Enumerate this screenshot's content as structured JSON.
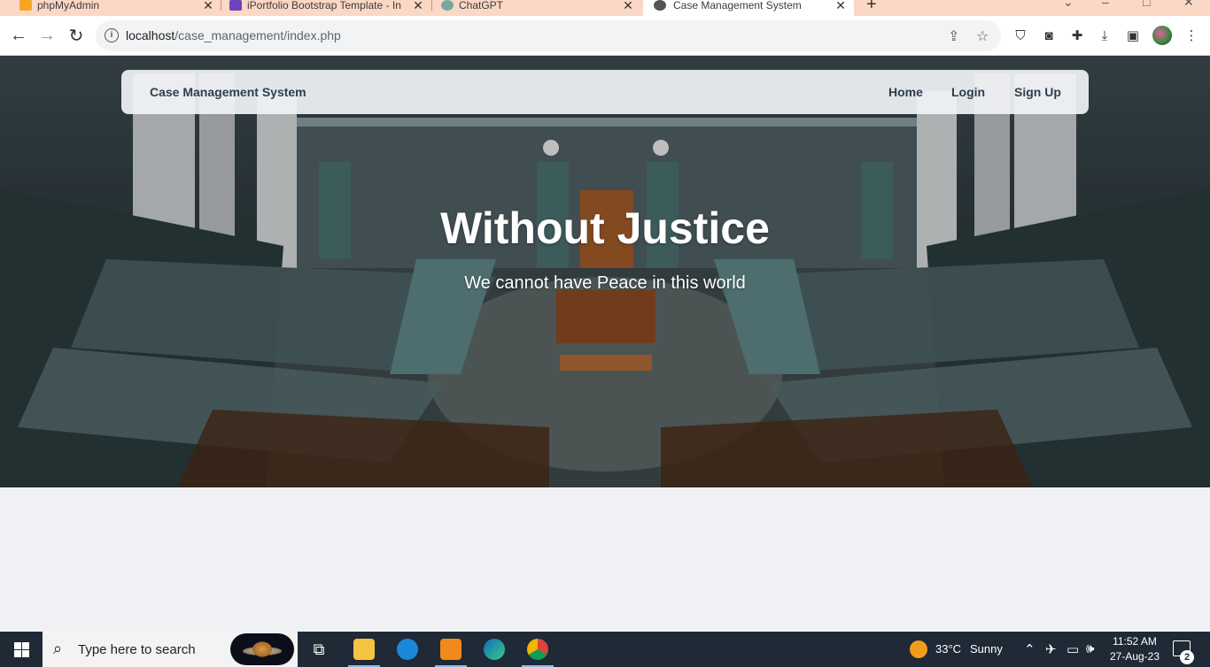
{
  "browser": {
    "tabs": [
      {
        "title": "phpMyAdmin",
        "favicon": "phpmyadmin-icon",
        "active": false
      },
      {
        "title": "iPortfolio Bootstrap Template - In",
        "favicon": "bootstrap-icon",
        "active": false
      },
      {
        "title": "ChatGPT",
        "favicon": "chatgpt-icon",
        "active": false
      },
      {
        "title": "Case Management System",
        "favicon": "globe-icon",
        "active": true
      }
    ],
    "close_glyph": "✕",
    "new_tab_glyph": "+",
    "address": {
      "host": "localhost",
      "path": "/case_management/index.php"
    }
  },
  "site": {
    "brand": "Case Management System",
    "nav": {
      "home": "Home",
      "login": "Login",
      "signup": "Sign Up"
    },
    "hero": {
      "title": "Without Justice",
      "subtitle": "We cannot have Peace in this world"
    }
  },
  "taskbar": {
    "search_placeholder": "Type here to search",
    "weather": {
      "temp": "33°C",
      "condition": "Sunny"
    },
    "clock": {
      "time": "11:52 AM",
      "date": "27-Aug-23"
    },
    "notifications": "2",
    "apps": [
      "task-view-icon",
      "file-explorer-icon",
      "edge-icon",
      "sublime-text-icon",
      "edge-icon",
      "chrome-icon"
    ]
  },
  "colors": {
    "tabstrip": "#fbd7c5",
    "nav_text": "#2d3e50",
    "taskbar": "#1f2a36",
    "page_bg": "#f0f1f5"
  }
}
